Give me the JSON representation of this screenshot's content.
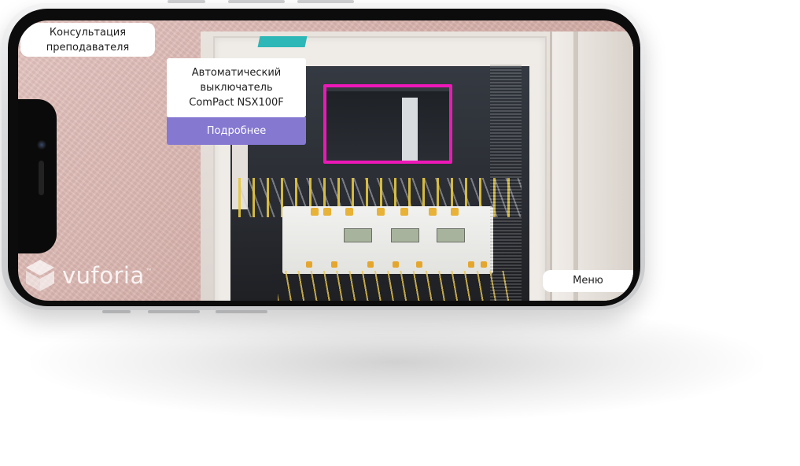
{
  "overlay": {
    "consult_label": "Консультация\nпреподавателя",
    "info_card_text": "Автоматический\nвыключатель\nComPact NSX100F",
    "more_label": "Подробнее",
    "menu_label": "Меню",
    "watermark_text": "vuforia",
    "watermark_tm": "™"
  },
  "colors": {
    "highlight": "#ee18b8",
    "more_button": "#8578d1"
  }
}
